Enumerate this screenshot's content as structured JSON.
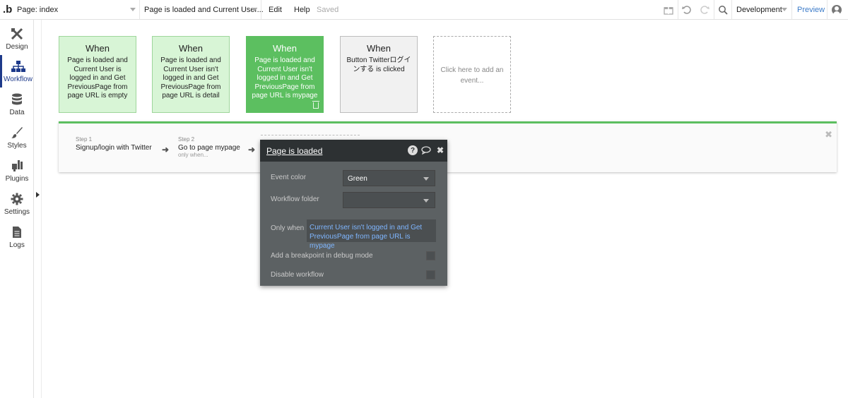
{
  "topbar": {
    "logo": ".b",
    "page_selector": "Page: index",
    "event_selector": "Page is loaded and Current User...",
    "menu": {
      "edit": "Edit",
      "help": "Help",
      "saved": "Saved"
    },
    "environment": "Development",
    "preview": "Preview"
  },
  "sidebar": {
    "items": [
      {
        "label": "Design",
        "icon": "design-icon"
      },
      {
        "label": "Workflow",
        "icon": "workflow-icon",
        "active": true
      },
      {
        "label": "Data",
        "icon": "database-icon"
      },
      {
        "label": "Styles",
        "icon": "brush-icon"
      },
      {
        "label": "Plugins",
        "icon": "plug-icon"
      },
      {
        "label": "Settings",
        "icon": "gear-icon"
      },
      {
        "label": "Logs",
        "icon": "document-icon"
      }
    ]
  },
  "events": [
    {
      "title": "When",
      "text": "Page is loaded and Current User is logged in and Get PreviousPage from page URL is empty",
      "color": "#d8f5d6"
    },
    {
      "title": "When",
      "text": "Page is loaded and Current User isn't logged in and Get PreviousPage from page URL is detail",
      "color": "#d8f5d6"
    },
    {
      "title": "When",
      "text": "Page is loaded and Current User isn't logged in and Get PreviousPage from page URL is mypage",
      "color": "#5cbf60",
      "selected": true
    },
    {
      "title": "When",
      "text": "Button Twitterログインする is clicked",
      "color": "#f1f1f1"
    },
    {
      "title": "",
      "text": "Click here to add an event..."
    }
  ],
  "steps": [
    {
      "number": "Step 1",
      "name": "Signup/login with Twitter",
      "when": ""
    },
    {
      "number": "Step 2",
      "name": "Go to page mypage",
      "when": "only when..."
    }
  ],
  "editor": {
    "title": "Page is loaded",
    "event_color_label": "Event color",
    "event_color_value": "Green",
    "workflow_folder_label": "Workflow folder",
    "workflow_folder_value": "",
    "only_when_label": "Only when",
    "only_when_value": "Current User isn't logged in and Get PreviousPage from page URL is mypage",
    "breakpoint_label": "Add a breakpoint in debug mode",
    "disable_label": "Disable workflow"
  },
  "colors": {
    "accent": "#5cbf60",
    "link": "#3d7cc9",
    "editor_bg": "#5c6163"
  }
}
